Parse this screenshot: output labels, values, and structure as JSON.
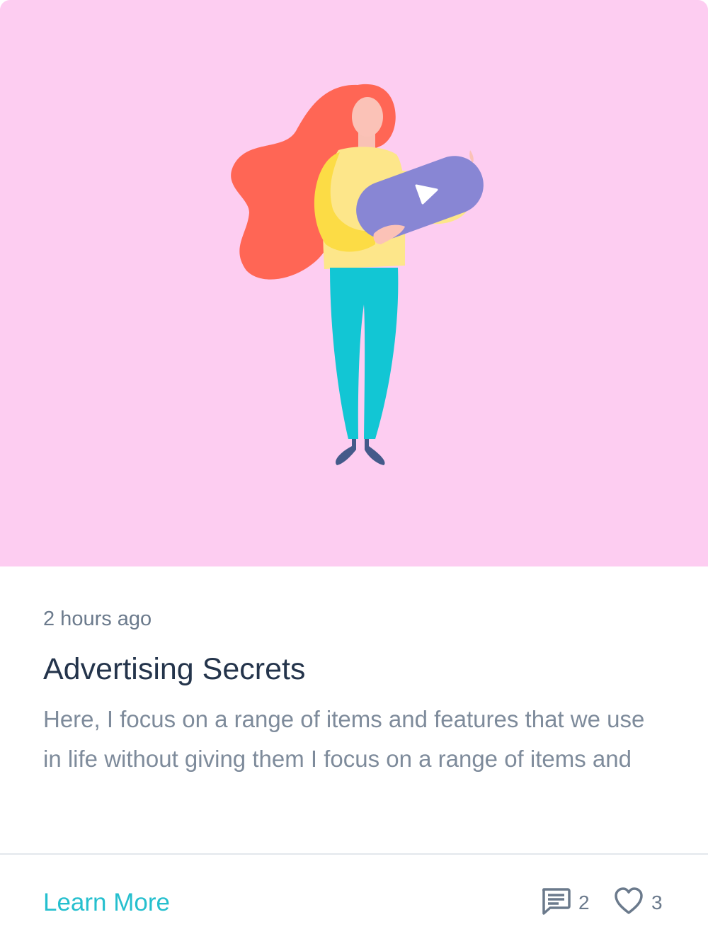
{
  "card": {
    "timestamp": "2 hours ago",
    "title": "Advertising Secrets",
    "excerpt": "Here, I focus on a range of items and features that we use in life without giving them I focus on a range of items and",
    "learn_more_label": "Learn More",
    "comments_count": "2",
    "likes_count": "3"
  },
  "icons": {
    "comments": "comment-icon",
    "likes": "heart-icon",
    "play": "play-icon"
  },
  "colors": {
    "hero_background": "#fdcdf1",
    "accent": "#25bfce",
    "title": "#24344b",
    "muted": "#6b7a8c"
  }
}
